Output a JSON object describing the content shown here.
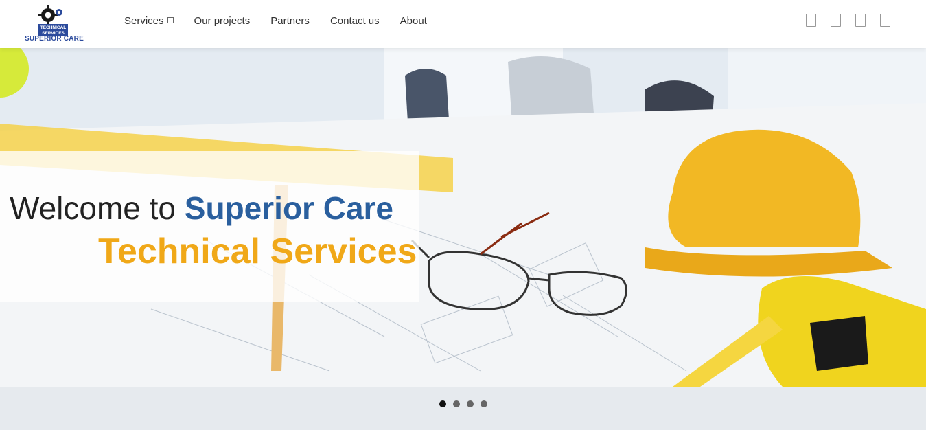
{
  "header": {
    "logo_line1": "TECHNICAL",
    "logo_line2": "SERVICES",
    "logo_name": "SUPERIOR CARE",
    "nav": [
      {
        "label": "Services",
        "has_dropdown": true
      },
      {
        "label": "Our projects"
      },
      {
        "label": "Partners"
      },
      {
        "label": "Contact us"
      },
      {
        "label": "About"
      }
    ],
    "social_icons": [
      "facebook-icon",
      "twitter-icon",
      "instagram-icon",
      "linkedin-icon"
    ]
  },
  "hero": {
    "title_prefix": "Welcome to ",
    "title_brand": "Superior Care",
    "subtitle": "Technical Services"
  },
  "carousel": {
    "count": 4,
    "active": 1
  }
}
